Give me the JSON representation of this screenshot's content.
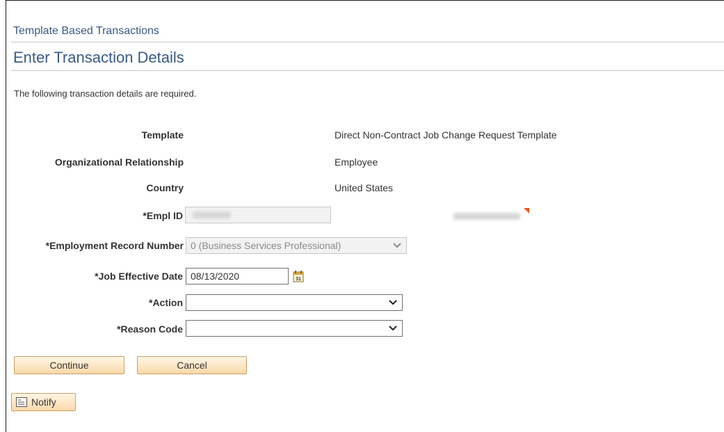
{
  "header": {
    "breadcrumb": "Template Based Transactions",
    "title": "Enter Transaction Details"
  },
  "instructions": "The following transaction details are required.",
  "details": {
    "template_label": "Template",
    "template_value": "Direct Non-Contract Job Change Request Template",
    "org_rel_label": "Organizational Relationship",
    "org_rel_value": "Employee",
    "country_label": "Country",
    "country_value": "United States"
  },
  "form": {
    "empl_id_label": "*Empl ID",
    "empl_id_value": "",
    "empl_rec_label": "*Employment Record Number",
    "empl_rec_value": "0 (Business Services Professional)",
    "job_eff_date_label": "*Job Effective Date",
    "job_eff_date_value": "08/13/2020",
    "action_label": "*Action",
    "action_value": "",
    "reason_label": "*Reason Code",
    "reason_value": ""
  },
  "buttons": {
    "continue": "Continue",
    "cancel": "Cancel",
    "notify": "Notify"
  },
  "icons": {
    "calendar": "calendar-icon",
    "notify": "notify-icon",
    "dropdown": "chevron-down-icon"
  },
  "colors": {
    "title": "#3a5a85",
    "button_fill": "#fbd9a8",
    "button_border": "#c9a063",
    "flag": "#e8561d"
  }
}
